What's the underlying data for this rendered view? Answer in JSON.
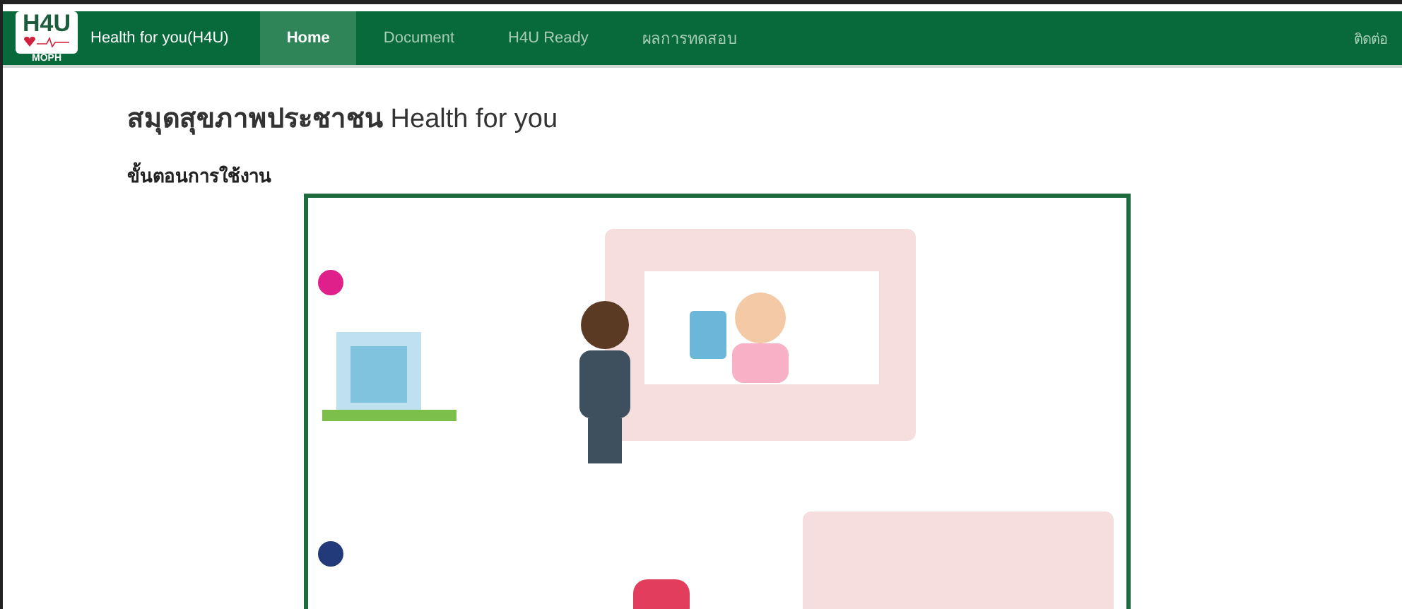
{
  "navbar": {
    "logo": {
      "mark": "H4U",
      "org": "MOPH"
    },
    "brand": "Health for you(H4U)",
    "tabs": [
      {
        "label": "Home",
        "selected": true
      },
      {
        "label": "Document",
        "selected": false
      },
      {
        "label": "H4U Ready",
        "selected": false
      },
      {
        "label": "ผลการทดสอบ",
        "selected": false
      }
    ],
    "contact": "ติดต่อ"
  },
  "page": {
    "heading": "**สมุดสุขภาพประชาชน** Health for you",
    "subheading": "ขั้นตอนการใช้งาน"
  }
}
